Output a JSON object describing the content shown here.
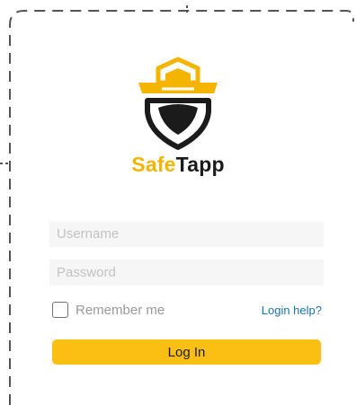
{
  "brand": {
    "part1": "Safe",
    "part2": "Tapp",
    "accent_color": "#f4b400",
    "logo_icon": "shield-hat-logo-icon"
  },
  "form": {
    "username_placeholder": "Username",
    "password_placeholder": "Password",
    "remember_label": "Remember me",
    "help_link": "Login help?",
    "login_label": "Log In",
    "button_color": "#fbbf14"
  }
}
